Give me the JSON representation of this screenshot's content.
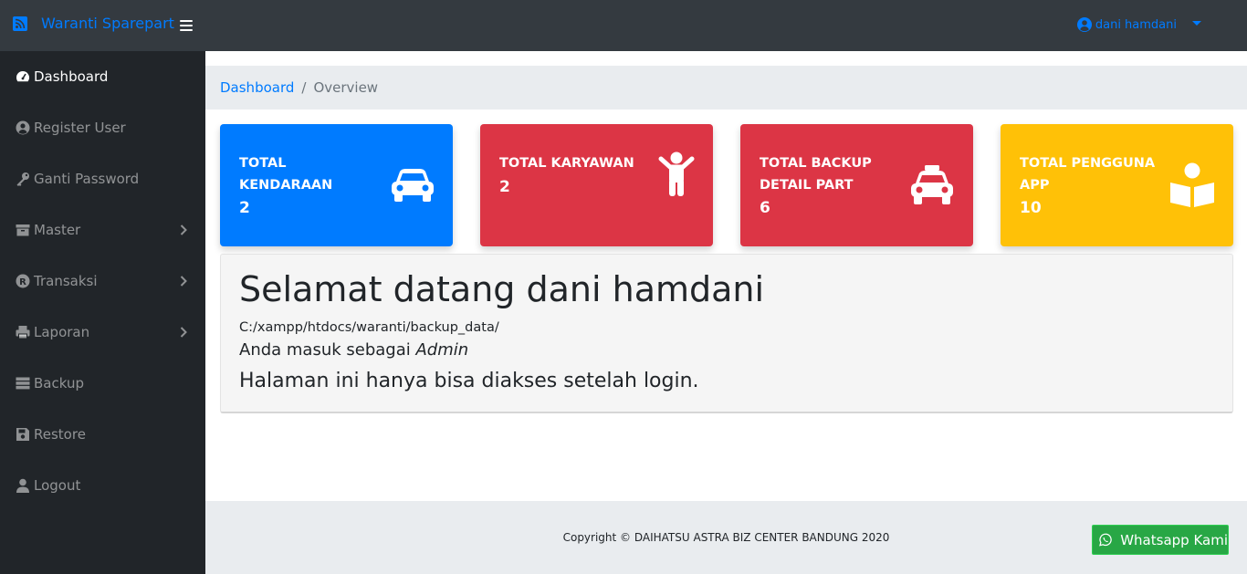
{
  "navbar": {
    "brand": "Waranti Sparepart",
    "brand_icon": "rss-icon",
    "toggle_icon": "hamburger-icon",
    "user_name": "dani hamdani",
    "user_icon": "user-circle-icon"
  },
  "sidebar": {
    "items": [
      {
        "label": "Dashboard",
        "icon": "tachometer-icon",
        "active": true
      },
      {
        "label": "Register User",
        "icon": "user-circle-icon"
      },
      {
        "label": "Ganti Password",
        "icon": "key-icon"
      },
      {
        "label": "Master",
        "icon": "archive-icon",
        "has_submenu": true
      },
      {
        "label": "Transaksi",
        "icon": "registered-icon",
        "has_submenu": true
      },
      {
        "label": "Laporan",
        "icon": "print-icon",
        "has_submenu": true
      },
      {
        "label": "Backup",
        "icon": "database-icon"
      },
      {
        "label": "Restore",
        "icon": "save-icon"
      },
      {
        "label": "Logout",
        "icon": "user-icon"
      }
    ]
  },
  "breadcrumb": {
    "link": "Dashboard",
    "separator": "/",
    "current": "Overview"
  },
  "cards": [
    {
      "title": "TOTAL KENDARAAN",
      "value": "2",
      "color": "#007bff",
      "icon": "car-icon"
    },
    {
      "title": "TOTAL KARYAWAN",
      "value": "2",
      "color": "#dc3545",
      "icon": "child-icon"
    },
    {
      "title": "TOTAL BACKUP DETAIL PART",
      "value": "6",
      "color": "#dc3545",
      "icon": "taxi-icon"
    },
    {
      "title": "TOTAL PENGGUNA APP",
      "value": "10",
      "color": "#ffc107",
      "icon": "book-reader-icon"
    }
  ],
  "welcome": {
    "heading": "Selamat datang dani hamdani",
    "path": "C:/xampp/htdocs/waranti/backup_data/",
    "role_prefix": "Anda masuk sebagai ",
    "role": "Admin",
    "note": "Halaman ini hanya bisa diakses setelah login."
  },
  "footer": {
    "copyright": "Copyright © DAIHATSU ASTRA BIZ CENTER BANDUNG 2020"
  },
  "whatsapp": {
    "label": "Whatsapp Kami",
    "icon": "whatsapp-icon"
  },
  "colors": {
    "navbar_bg": "#343a40",
    "sidebar_bg": "#212529",
    "primary": "#007bff",
    "danger": "#dc3545",
    "warning": "#ffc107",
    "success": "#28a745"
  }
}
